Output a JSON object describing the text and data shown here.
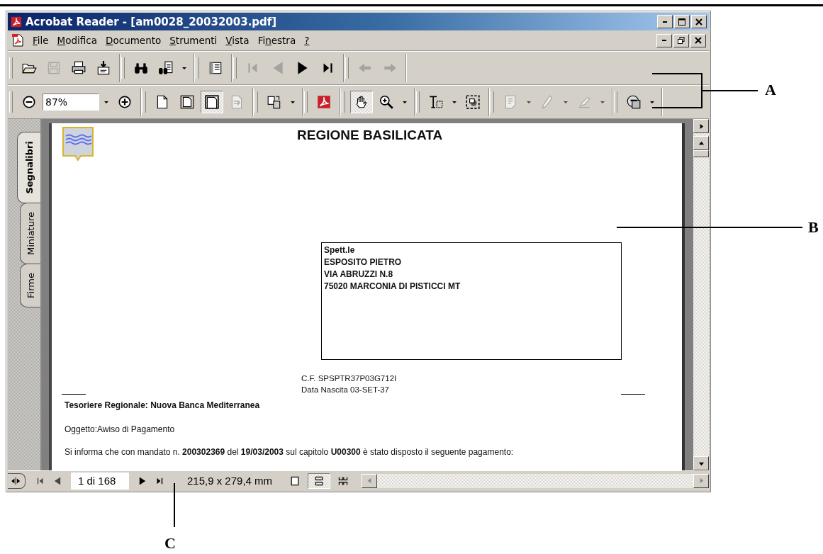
{
  "window": {
    "title": "Acrobat Reader - [am0028_20032003.pdf]"
  },
  "menu": [
    {
      "key": "F",
      "post": "ile"
    },
    {
      "key": "M",
      "post": "odifica"
    },
    {
      "key": "D",
      "post": "ocumento"
    },
    {
      "key": "S",
      "post": "trumenti"
    },
    {
      "key": "V",
      "post": "ista"
    },
    {
      "pre": "Fi",
      "key": "n",
      "post": "estra"
    },
    {
      "key": "?"
    }
  ],
  "toolbars": [
    {
      "groups": [
        [
          {
            "kind": "open",
            "disabled": false,
            "pressed": false
          },
          {
            "kind": "save",
            "disabled": true,
            "pressed": false
          },
          {
            "kind": "print",
            "disabled": false,
            "pressed": false
          },
          {
            "kind": "tray",
            "disabled": false,
            "pressed": false
          }
        ],
        [
          {
            "kind": "search",
            "disabled": false,
            "pressed": false
          },
          {
            "kind": "searchdoc",
            "disabled": false,
            "pressed": false
          },
          {
            "kind": "dropdown",
            "disabled": false
          }
        ],
        [
          {
            "kind": "panel",
            "disabled": false,
            "pressed": false
          }
        ],
        [
          {
            "kind": "first",
            "disabled": true,
            "pressed": false
          },
          {
            "kind": "prev",
            "disabled": true,
            "pressed": false
          },
          {
            "kind": "next",
            "disabled": false,
            "pressed": false
          },
          {
            "kind": "last",
            "disabled": false,
            "pressed": false
          }
        ],
        [
          {
            "kind": "back",
            "disabled": true,
            "pressed": false
          },
          {
            "kind": "forward",
            "disabled": true,
            "pressed": false
          }
        ]
      ]
    },
    {
      "groups": [
        [
          {
            "kind": "zoomout",
            "disabled": false,
            "pressed": false
          },
          {
            "kind": "field",
            "value": "87%"
          },
          {
            "kind": "dropdown",
            "disabled": false
          },
          {
            "kind": "zoomin",
            "disabled": false,
            "pressed": false
          }
        ],
        [
          {
            "kind": "actualsize",
            "disabled": false,
            "pressed": false
          },
          {
            "kind": "fitpage",
            "disabled": false,
            "pressed": false
          },
          {
            "kind": "fitwidth",
            "disabled": false,
            "pressed": true
          },
          {
            "kind": "reflow",
            "disabled": true,
            "pressed": false
          }
        ],
        [
          {
            "kind": "rotate",
            "disabled": false,
            "pressed": false
          },
          {
            "kind": "dropdown",
            "disabled": false
          }
        ],
        [
          {
            "kind": "acrobat",
            "disabled": false,
            "pressed": false
          }
        ],
        [
          {
            "kind": "hand",
            "disabled": false,
            "pressed": true
          },
          {
            "kind": "magnifier",
            "disabled": false,
            "pressed": false
          },
          {
            "kind": "dropdown",
            "disabled": false
          }
        ],
        [
          {
            "kind": "textselect",
            "disabled": false,
            "pressed": false
          },
          {
            "kind": "dropdown",
            "disabled": false
          },
          {
            "kind": "snapshot",
            "disabled": false,
            "pressed": false
          }
        ],
        [
          {
            "kind": "note",
            "disabled": true,
            "pressed": false
          },
          {
            "kind": "dropdown",
            "disabled": true
          },
          {
            "kind": "pencil",
            "disabled": true,
            "pressed": false
          },
          {
            "kind": "dropdown",
            "disabled": true
          },
          {
            "kind": "highlighter",
            "disabled": true,
            "pressed": false
          },
          {
            "kind": "dropdown",
            "disabled": true
          }
        ],
        [
          {
            "kind": "comments",
            "disabled": false,
            "pressed": false
          },
          {
            "kind": "dropdown",
            "disabled": false
          }
        ]
      ]
    }
  ],
  "side_tabs": [
    {
      "label": "Segnalibri",
      "selected": true
    },
    {
      "label": "Miniature",
      "selected": false
    },
    {
      "label": "Firme",
      "selected": false
    }
  ],
  "document": {
    "heading": "REGIONE BASILICATA",
    "address": [
      "Spett.le",
      "ESPOSITO PIETRO",
      "VIA ABRUZZI N.8",
      "75020 MARCONIA DI PISTICCI MT"
    ],
    "details": [
      "C.F. SPSPTR37P03G712I",
      "Data Nascita 03-SET-37"
    ],
    "treasurer": "Tesoriere Regionale: Nuova Banca Mediterranea",
    "subject": "Oggetto:Awiso di Pagamento",
    "body": "Si informa che con mandato n. **200302369**  del **19/03/2003** sul capitolo **U00300**  è stato disposto il seguente pagamento:"
  },
  "status_bar": {
    "nav": [
      {
        "kind": "first",
        "disabled": true
      },
      {
        "kind": "prev",
        "disabled": true
      }
    ],
    "page_field": "1 di 168",
    "nav_after": [
      {
        "kind": "next",
        "disabled": false
      },
      {
        "kind": "last",
        "disabled": false
      }
    ],
    "page_size": "215,9 x 279,4 mm",
    "layouts": [
      {
        "kind": "single",
        "selected": false
      },
      {
        "kind": "continuous",
        "selected": true
      },
      {
        "kind": "facing",
        "selected": false
      }
    ]
  },
  "callouts": [
    {
      "label": "A"
    },
    {
      "label": "B"
    },
    {
      "label": "C"
    }
  ]
}
